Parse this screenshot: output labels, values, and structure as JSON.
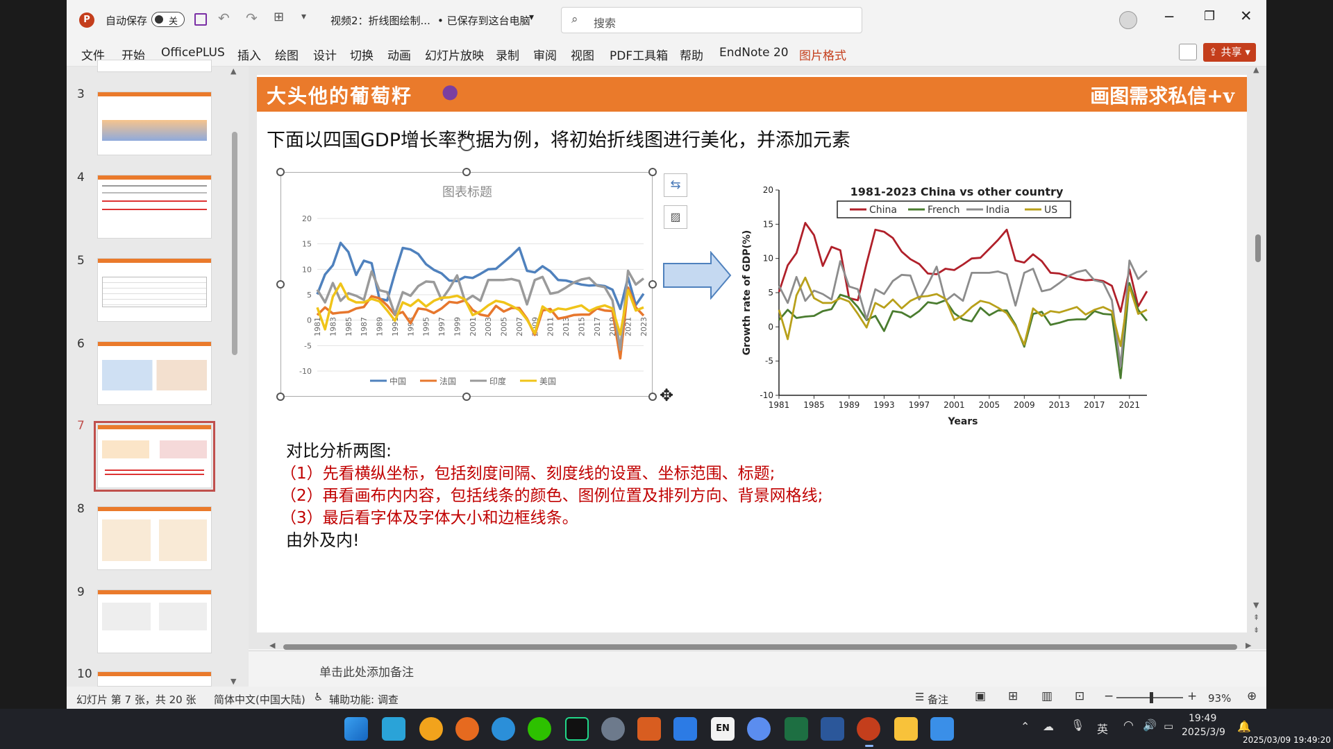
{
  "titlebar": {
    "autosave_label": "自动保存",
    "autosave_state": "关",
    "doc_title": "视频2：折线图绘制...",
    "save_status": "• 已保存到这台电脑",
    "search_placeholder": "搜索"
  },
  "ribbon": {
    "tabs": [
      "文件",
      "开始",
      "OfficePLUS",
      "插入",
      "绘图",
      "设计",
      "切换",
      "动画",
      "幻灯片放映",
      "录制",
      "审阅",
      "视图",
      "PDF工具箱",
      "帮助",
      "EndNote 20",
      "图片格式"
    ],
    "share_label": "共享"
  },
  "thumbnails": {
    "numbers": [
      "3",
      "4",
      "5",
      "6",
      "7",
      "8",
      "9",
      "10"
    ],
    "selected": "7"
  },
  "slide": {
    "banner_left": "大头他的葡萄籽",
    "banner_right": "画图需求私信+v",
    "heading": "下面以四国GDP增长率数据为例，将初始折线图进行美化，并添加元素",
    "analysis_title": "对比分析两图:",
    "points": [
      "（1）先看横纵坐标，包括刻度间隔、刻度线的设置、坐标范围、标题;",
      "（2）再看画布内内容，包括线条的颜色、图例位置及排列方向、背景网格线;",
      "（3）最后看字体及字体大小和边框线条。"
    ],
    "conclusion": "由外及内!"
  },
  "chart_data": [
    {
      "type": "line",
      "title": "图表标题",
      "x": [
        1981,
        1982,
        1983,
        1984,
        1985,
        1986,
        1987,
        1988,
        1989,
        1990,
        1991,
        1992,
        1993,
        1994,
        1995,
        1996,
        1997,
        1998,
        1999,
        2000,
        2001,
        2002,
        2003,
        2004,
        2005,
        2006,
        2007,
        2008,
        2009,
        2010,
        2011,
        2012,
        2013,
        2014,
        2015,
        2016,
        2017,
        2018,
        2019,
        2020,
        2021,
        2022,
        2023
      ],
      "x_tick_labels": [
        "1981",
        "1983",
        "1985",
        "1987",
        "1989",
        "1991",
        "1993",
        "1995",
        "1997",
        "1999",
        "2001",
        "2003",
        "2005",
        "2007",
        "2009",
        "2011",
        "2013",
        "2015",
        "2017",
        "2019",
        "2021",
        "2023"
      ],
      "ylim": [
        -10,
        20
      ],
      "y_ticks": [
        -10,
        -5,
        0,
        5,
        10,
        15,
        20
      ],
      "legend_position": "bottom",
      "series": [
        {
          "name": "中国",
          "color": "#4f81bd",
          "values": [
            5.1,
            9.0,
            10.8,
            15.2,
            13.4,
            8.9,
            11.7,
            11.2,
            4.2,
            3.9,
            9.3,
            14.2,
            13.9,
            13.0,
            11.0,
            9.9,
            9.2,
            7.8,
            7.7,
            8.5,
            8.3,
            9.1,
            10.0,
            10.1,
            11.4,
            12.7,
            14.2,
            9.7,
            9.4,
            10.6,
            9.6,
            7.9,
            7.8,
            7.4,
            7.0,
            6.8,
            6.9,
            6.7,
            6.0,
            2.2,
            8.4,
            3.0,
            5.2
          ]
        },
        {
          "name": "法国",
          "color": "#e7772d",
          "values": [
            1.0,
            2.5,
            1.3,
            1.5,
            1.6,
            2.3,
            2.6,
            4.7,
            4.3,
            2.9,
            1.0,
            1.6,
            -0.6,
            2.3,
            2.1,
            1.4,
            2.3,
            3.6,
            3.4,
            3.9,
            2.0,
            1.1,
            0.8,
            2.8,
            1.7,
            2.4,
            2.4,
            0.3,
            -2.9,
            1.9,
            2.2,
            0.3,
            0.6,
            1.0,
            1.1,
            1.1,
            2.3,
            1.9,
            1.8,
            -7.5,
            6.4,
            2.5,
            0.9
          ]
        },
        {
          "name": "印度",
          "color": "#9a9a9a",
          "values": [
            6.0,
            3.5,
            7.3,
            3.8,
            5.3,
            4.8,
            4.0,
            9.6,
            5.9,
            5.5,
            1.1,
            5.5,
            4.8,
            6.7,
            7.6,
            7.5,
            4.0,
            6.2,
            8.8,
            3.8,
            4.8,
            3.8,
            7.9,
            7.9,
            7.9,
            8.1,
            7.7,
            3.1,
            7.9,
            8.5,
            5.2,
            5.5,
            6.4,
            7.4,
            8.0,
            8.3,
            6.8,
            6.5,
            3.9,
            -5.8,
            9.7,
            7.0,
            8.2
          ]
        },
        {
          "name": "美国",
          "color": "#f0c419",
          "values": [
            2.5,
            -1.8,
            4.6,
            7.2,
            4.2,
            3.5,
            3.5,
            4.2,
            3.7,
            1.9,
            -0.1,
            3.5,
            2.8,
            4.0,
            2.7,
            3.8,
            4.4,
            4.5,
            4.8,
            4.1,
            1.0,
            1.7,
            2.9,
            3.8,
            3.5,
            2.8,
            2.0,
            0.1,
            -2.6,
            2.7,
            1.6,
            2.3,
            2.1,
            2.5,
            2.9,
            1.8,
            2.5,
            2.9,
            2.3,
            -2.8,
            5.9,
            1.9,
            2.5
          ]
        }
      ]
    },
    {
      "type": "line",
      "title": "1981-2023 China vs other country",
      "xlabel": "Years",
      "ylabel": "Growth rate of GDP(%)",
      "x": [
        1981,
        1982,
        1983,
        1984,
        1985,
        1986,
        1987,
        1988,
        1989,
        1990,
        1991,
        1992,
        1993,
        1994,
        1995,
        1996,
        1997,
        1998,
        1999,
        2000,
        2001,
        2002,
        2003,
        2004,
        2005,
        2006,
        2007,
        2008,
        2009,
        2010,
        2011,
        2012,
        2013,
        2014,
        2015,
        2016,
        2017,
        2018,
        2019,
        2020,
        2021,
        2022,
        2023
      ],
      "x_tick_labels": [
        "1981",
        "1985",
        "1989",
        "1993",
        "1997",
        "2001",
        "2005",
        "2009",
        "2013",
        "2017",
        "2021"
      ],
      "ylim": [
        -10,
        20
      ],
      "y_ticks": [
        -10,
        -5,
        0,
        5,
        10,
        15,
        20
      ],
      "legend_position": "top",
      "series": [
        {
          "name": "China",
          "color": "#b0202a",
          "values": [
            5.1,
            9.0,
            10.8,
            15.2,
            13.4,
            8.9,
            11.7,
            11.2,
            4.2,
            3.9,
            9.3,
            14.2,
            13.9,
            13.0,
            11.0,
            9.9,
            9.2,
            7.8,
            7.7,
            8.5,
            8.3,
            9.1,
            10.0,
            10.1,
            11.4,
            12.7,
            14.2,
            9.7,
            9.4,
            10.6,
            9.6,
            7.9,
            7.8,
            7.4,
            7.0,
            6.8,
            6.9,
            6.7,
            6.0,
            2.2,
            8.4,
            3.0,
            5.2
          ]
        },
        {
          "name": "French",
          "color": "#4a7c2f",
          "values": [
            1.0,
            2.5,
            1.3,
            1.5,
            1.6,
            2.3,
            2.6,
            4.7,
            4.3,
            2.9,
            1.0,
            1.6,
            -0.6,
            2.3,
            2.1,
            1.4,
            2.3,
            3.6,
            3.4,
            3.9,
            2.0,
            1.1,
            0.8,
            2.8,
            1.7,
            2.4,
            2.4,
            0.3,
            -2.9,
            1.9,
            2.2,
            0.3,
            0.6,
            1.0,
            1.1,
            1.1,
            2.3,
            1.9,
            1.8,
            -7.5,
            6.4,
            2.5,
            0.9
          ]
        },
        {
          "name": "India",
          "color": "#8c8c8c",
          "values": [
            6.0,
            3.5,
            7.3,
            3.8,
            5.3,
            4.8,
            4.0,
            9.6,
            5.9,
            5.5,
            1.1,
            5.5,
            4.8,
            6.7,
            7.6,
            7.5,
            4.0,
            6.2,
            8.8,
            3.8,
            4.8,
            3.8,
            7.9,
            7.9,
            7.9,
            8.1,
            7.7,
            3.1,
            7.9,
            8.5,
            5.2,
            5.5,
            6.4,
            7.4,
            8.0,
            8.3,
            6.8,
            6.5,
            3.9,
            -5.8,
            9.7,
            7.0,
            8.2
          ]
        },
        {
          "name": "US",
          "color": "#b8a01a",
          "values": [
            2.5,
            -1.8,
            4.6,
            7.2,
            4.2,
            3.5,
            3.5,
            4.2,
            3.7,
            1.9,
            -0.1,
            3.5,
            2.8,
            4.0,
            2.7,
            3.8,
            4.4,
            4.5,
            4.8,
            4.1,
            1.0,
            1.7,
            2.9,
            3.8,
            3.5,
            2.8,
            2.0,
            0.1,
            -2.6,
            2.7,
            1.6,
            2.3,
            2.1,
            2.5,
            2.9,
            1.8,
            2.5,
            2.9,
            2.3,
            -2.8,
            5.9,
            1.9,
            2.5
          ]
        }
      ]
    }
  ],
  "notes": {
    "placeholder": "单击此处添加备注"
  },
  "statusbar": {
    "slide_info": "幻灯片 第 7 张，共 20 张",
    "language": "简体中文(中国大陆)",
    "accessibility": "辅助功能: 调查",
    "notes_label": "备注",
    "zoom": "93%"
  },
  "taskbar": {
    "ime": "英",
    "time": "19:49",
    "date": "2025/3/9",
    "timestamp_overlay": "2025/03/09 19:49:20",
    "lang_icon": "EN"
  }
}
